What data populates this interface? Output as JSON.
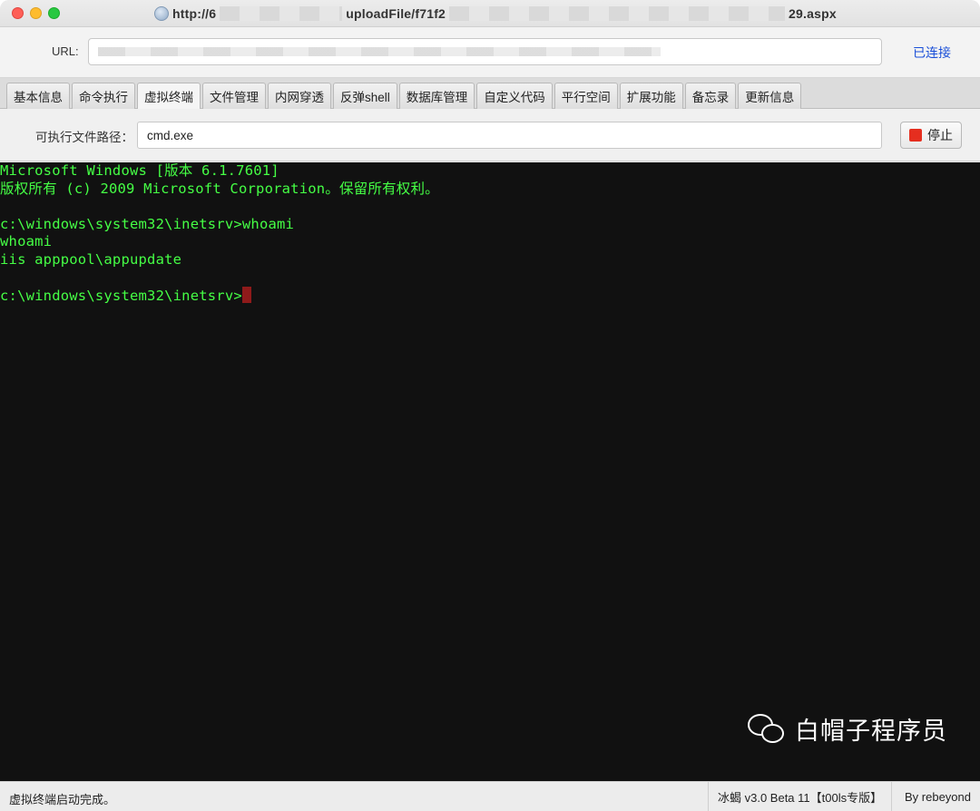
{
  "window": {
    "title_prefix": "http://6",
    "title_middle": "uploadFile/f71f2",
    "title_suffix": "29.aspx"
  },
  "url_bar": {
    "label": "URL:",
    "value": "",
    "connection_status": "已连接"
  },
  "tabs": [
    {
      "label": "基本信息"
    },
    {
      "label": "命令执行"
    },
    {
      "label": "虚拟终端",
      "active": true
    },
    {
      "label": "文件管理"
    },
    {
      "label": "内网穿透"
    },
    {
      "label": "反弹shell"
    },
    {
      "label": "数据库管理"
    },
    {
      "label": "自定义代码"
    },
    {
      "label": "平行空间"
    },
    {
      "label": "扩展功能"
    },
    {
      "label": "备忘录"
    },
    {
      "label": "更新信息"
    }
  ],
  "path_bar": {
    "label": "可执行文件路径：",
    "value": "cmd.exe",
    "stop_label": "停止"
  },
  "terminal": {
    "lines": [
      "Microsoft Windows [版本 6.1.7601]",
      "版权所有 (c) 2009 Microsoft Corporation。保留所有权利。",
      "",
      "c:\\windows\\system32\\inetsrv>whoami",
      "whoami",
      "iis apppool\\appupdate",
      "",
      "c:\\windows\\system32\\inetsrv>"
    ],
    "text_color": "#45ff45",
    "background": "#111111"
  },
  "watermark": {
    "text": "白帽子程序员",
    "icon": "wechat-icon"
  },
  "status_bar": {
    "message": "虚拟终端启动完成。",
    "version": "冰蝎 v3.0 Beta 11【t00ls专版】",
    "author": "By rebeyond"
  }
}
